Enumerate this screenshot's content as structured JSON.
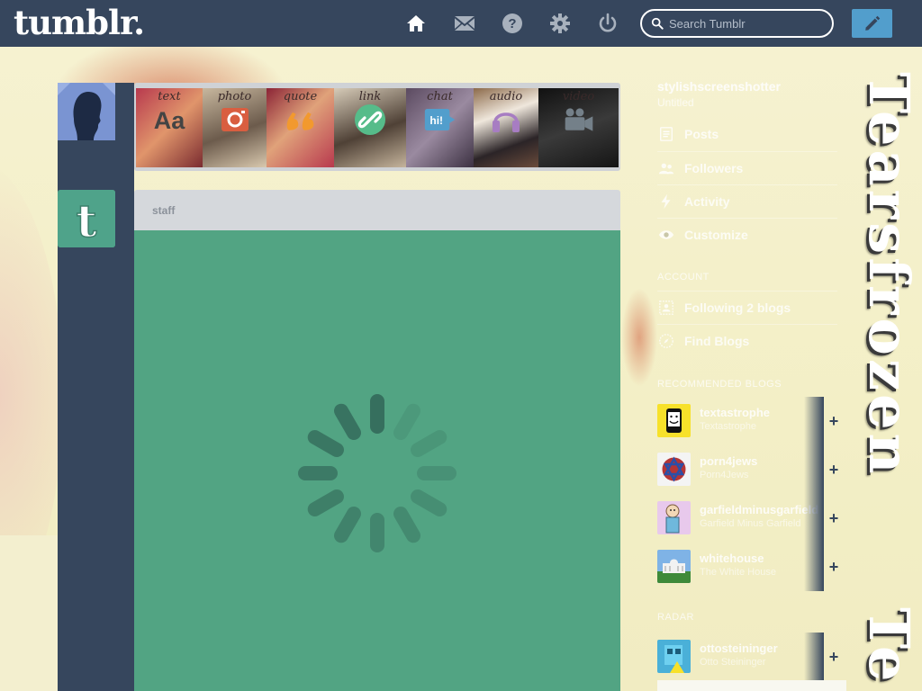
{
  "app": {
    "logo": "tumblr."
  },
  "header": {
    "nav": [
      {
        "name": "home-icon",
        "label": "Dashboard"
      },
      {
        "name": "mail-icon",
        "label": "Messages"
      },
      {
        "name": "help-icon",
        "label": "Help"
      },
      {
        "name": "gear-icon",
        "label": "Settings"
      },
      {
        "name": "power-icon",
        "label": "Log out"
      }
    ],
    "search_placeholder": "Search Tumblr",
    "compose_icon": "pencil-icon"
  },
  "post_types": [
    {
      "label": "text",
      "icon": "text-icon",
      "color": "#444444"
    },
    {
      "label": "photo",
      "icon": "camera-icon",
      "color": "#d95e40"
    },
    {
      "label": "quote",
      "icon": "quote-icon",
      "color": "#f2992e"
    },
    {
      "label": "link",
      "icon": "link-icon",
      "color": "#56bc8a"
    },
    {
      "label": "chat",
      "icon": "chat-icon",
      "color": "#529ecc"
    },
    {
      "label": "audio",
      "icon": "headphones-icon",
      "color": "#a77dc2"
    },
    {
      "label": "video",
      "icon": "video-icon",
      "color": "#748089"
    }
  ],
  "feed": {
    "post_author": "staff",
    "post_color": "#52a483",
    "loading": true
  },
  "sidebar": {
    "blog_name": "stylishscreenshotter",
    "blog_subtitle": "Untitled",
    "menu": [
      {
        "label": "Posts",
        "icon": "posts-icon"
      },
      {
        "label": "Followers",
        "icon": "followers-icon"
      },
      {
        "label": "Activity",
        "icon": "activity-icon"
      },
      {
        "label": "Customize",
        "icon": "eye-icon"
      }
    ],
    "account_title": "Account",
    "account_menu": [
      {
        "label": "Following 2 blogs",
        "icon": "following-icon"
      },
      {
        "label": "Find Blogs",
        "icon": "compass-icon"
      }
    ],
    "recommended_title": "Recommended Blogs",
    "recommended": [
      {
        "name": "textastrophe",
        "title": "Textastrophe"
      },
      {
        "name": "porn4jews",
        "title": "Porn4Jews"
      },
      {
        "name": "garfieldminusgarfield",
        "title": "Garfield Minus Garfield"
      },
      {
        "name": "whitehouse",
        "title": "The White House"
      }
    ],
    "radar_title": "Radar",
    "radar": [
      {
        "name": "ottosteininger",
        "title": "Otto Steininger"
      }
    ]
  },
  "watermark": {
    "text": "Tearsfrozen",
    "text_repeat": "Te"
  }
}
